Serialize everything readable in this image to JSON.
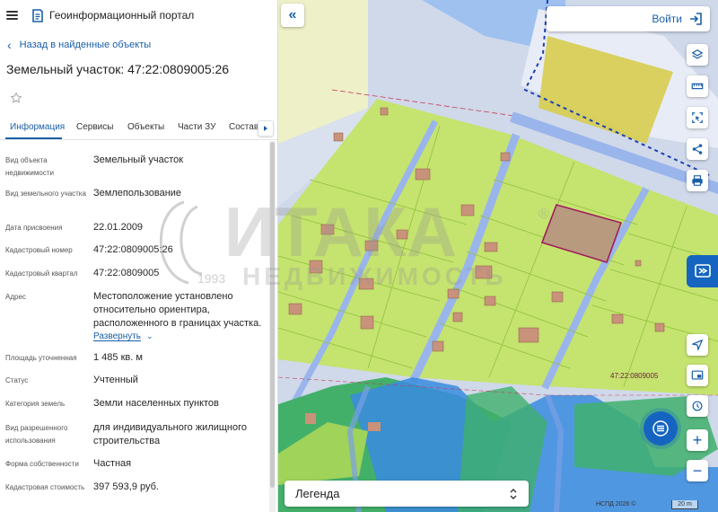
{
  "app": {
    "title": "Геоинформационный портал"
  },
  "panel": {
    "back_label": "Назад в найденные объекты",
    "object_title": "Земельный участок: 47:22:0809005:26",
    "tabs": [
      "Информация",
      "Сервисы",
      "Объекты",
      "Части ЗУ",
      "Состав"
    ],
    "active_tab": "Информация",
    "expand_label": "Развернуть",
    "properties": [
      {
        "label": "Вид объекта недвижимости",
        "value": "Земельный участок"
      },
      {
        "label": "Вид земельного участка",
        "value": "Землепользование"
      },
      {
        "label": "Дата присвоения",
        "value": "22.01.2009"
      },
      {
        "label": "Кадастровый номер",
        "value": "47:22:0809005:26"
      },
      {
        "label": "Кадастровый квартал",
        "value": "47:22:0809005"
      },
      {
        "label": "Адрес",
        "value": "Местоположение установлено относительно ориентира, расположенного в границах участка."
      },
      {
        "label": "Площадь уточненная",
        "value": "1 485 кв. м"
      },
      {
        "label": "Статус",
        "value": "Учтенный"
      },
      {
        "label": "Категория земель",
        "value": "Земли населенных пунктов"
      },
      {
        "label": "Вид разрешенного использования",
        "value": "для индивидуального жилищного строительства"
      },
      {
        "label": "Форма собственности",
        "value": "Частная"
      },
      {
        "label": "Кадастровая стоимость",
        "value": "397 593,9 руб."
      }
    ]
  },
  "map": {
    "login_label": "Войти",
    "legend_label": "Легенда",
    "quarter_label": "47:22:0809005",
    "attribution": "НСПД 2026 ©",
    "scale_label": "20 m",
    "watermark": {
      "brand": "ИТАКА",
      "year": "1993",
      "subtitle": "НЕДВИЖИМОСТЬ",
      "registered": "®"
    }
  },
  "icons": {
    "menu": "hamburger-icon",
    "logo": "portal-logo-icon",
    "back": "chevron-left-icon",
    "favorite": "star-icon",
    "collapse": "double-chevron-left-icon",
    "login": "login-icon",
    "layers": "layers-icon",
    "measure": "ruler-icon",
    "select_area": "select-area-icon",
    "share": "share-icon",
    "print": "print-icon",
    "locate": "navigation-arrow-icon",
    "screen": "screen-icon",
    "zoom_in": "plus-icon",
    "zoom_out": "minus-icon"
  },
  "colors": {
    "accent": "#1a5fa8",
    "primary_button": "#1565c0",
    "parcel_fill": "#c5e36f",
    "parcel_border": "#8fc23c",
    "selected_parcel": "#a11c5c",
    "water": "#3a8be0",
    "forest": "#43b06a"
  }
}
